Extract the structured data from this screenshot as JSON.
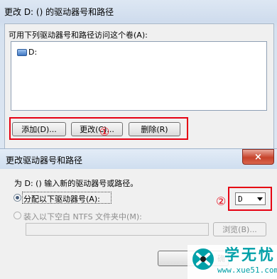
{
  "dialog1": {
    "title": "更改 D: () 的驱动器号和路径",
    "list_label": "可用下列驱动器号和路径访问这个卷(A):",
    "list_items": [
      "D:"
    ],
    "buttons": {
      "add": "添加(D)...",
      "change": "更改(C)...",
      "remove": "删除(R)"
    },
    "annotation": "①"
  },
  "dialog2": {
    "title": "更改驱动器号和路径",
    "close": "×",
    "prompt": "为 D: () 输入新的驱动器号或路径。",
    "option_assign": "分配以下驱动器号(A):",
    "option_mount": "装入以下空白 NTFS 文件夹中(M):",
    "drive_letter": "D",
    "browse": "浏览(B)...",
    "ok": "确",
    "annotation": "②"
  },
  "watermark": {
    "logo_text": "学无忧",
    "url": "www.xue51.com"
  },
  "colors": {
    "annotation": "#e60012",
    "watermark": "#00a0a8"
  }
}
